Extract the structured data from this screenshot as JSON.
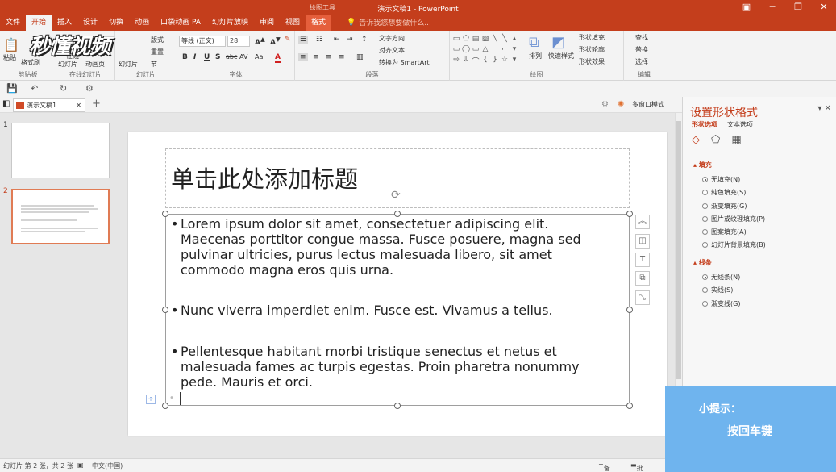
{
  "window": {
    "context_label": "绘图工具",
    "title": "演示文稿1 - PowerPoint",
    "buttons": [
      "▣",
      "─",
      "❐",
      "✕"
    ]
  },
  "tabs": [
    {
      "label": "文件"
    },
    {
      "label": "开始"
    },
    {
      "label": "插入"
    },
    {
      "label": "设计"
    },
    {
      "label": "切换"
    },
    {
      "label": "动画"
    },
    {
      "label": "口袋动画 PA"
    },
    {
      "label": "幻灯片放映"
    },
    {
      "label": "审阅"
    },
    {
      "label": "视图"
    },
    {
      "label": "格式"
    }
  ],
  "tell_me": "告诉我您想要做什么...",
  "watermark": "秒懂视频",
  "ribbon": {
    "clipboard": {
      "paste": "粘贴",
      "format_painter": "格式刷",
      "group": "剪贴板"
    },
    "online": {
      "b1": "在线",
      "b2": "幻灯片",
      "b3": "动画页",
      "group": "在线幻灯片"
    },
    "slides": {
      "new": "新建",
      "layout": "版式",
      "reset": "重置",
      "section": "节",
      "new_slide": "幻灯片",
      "group": "幻灯片"
    },
    "font": {
      "name": "等线 (正文)",
      "size": "28",
      "group": "字体"
    },
    "paragraph": {
      "text_direction": "文字方向",
      "align_text": "对齐文本",
      "smartart": "转换为 SmartArt",
      "group": "段落"
    },
    "drawing": {
      "arrange": "排列",
      "quick_styles": "快速样式",
      "shape_fill": "形状填充",
      "shape_outline": "形状轮廓",
      "shape_effects": "形状效果",
      "group": "绘图"
    },
    "editing": {
      "find": "查找",
      "replace": "替换",
      "select": "选择",
      "group": "编辑"
    }
  },
  "doc_tab": {
    "label": "演示文稿1",
    "multi_window": "多窗口模式"
  },
  "thumbnails": [
    {
      "number": "1"
    },
    {
      "number": "2"
    }
  ],
  "slide": {
    "title": "单击此处添加标题",
    "bullets": [
      "Lorem ipsum dolor sit amet, consectetuer adipiscing elit. Maecenas porttitor congue massa. Fusce posuere, magna sed pulvinar ultricies, purus lectus malesuada libero, sit amet commodo magna eros quis urna.",
      "Nunc viverra imperdiet enim. Fusce est. Vivamus a tellus.",
      "Pellentesque habitant morbi tristique senectus et netus et malesuada fames ac turpis egestas. Proin pharetra nonummy pede. Mauris et orci."
    ]
  },
  "format_pane": {
    "title": "设置形状格式",
    "tabs": [
      "形状选项",
      "文本选项"
    ],
    "fill_section": "填充",
    "fill_options": [
      {
        "label": "无填充(N)",
        "checked": true
      },
      {
        "label": "纯色填充(S)",
        "checked": false
      },
      {
        "label": "渐变填充(G)",
        "checked": false
      },
      {
        "label": "图片或纹理填充(P)",
        "checked": false
      },
      {
        "label": "图案填充(A)",
        "checked": false
      },
      {
        "label": "幻灯片背景填充(B)",
        "checked": false
      }
    ],
    "line_section": "线条",
    "line_options": [
      {
        "label": "无线条(N)",
        "checked": true
      },
      {
        "label": "实线(S)",
        "checked": false
      },
      {
        "label": "渐变线(G)",
        "checked": false
      }
    ]
  },
  "tip": {
    "heading": "小提示：",
    "text": "按回车键"
  },
  "status": {
    "slide_info": "幻灯片 第 2 张，共 2 张",
    "language": "中文(中国)",
    "notes": "备注",
    "comments": "批注"
  },
  "colors": {
    "accent": "#c43e1c",
    "tip_bg": "#6fb4ee"
  }
}
